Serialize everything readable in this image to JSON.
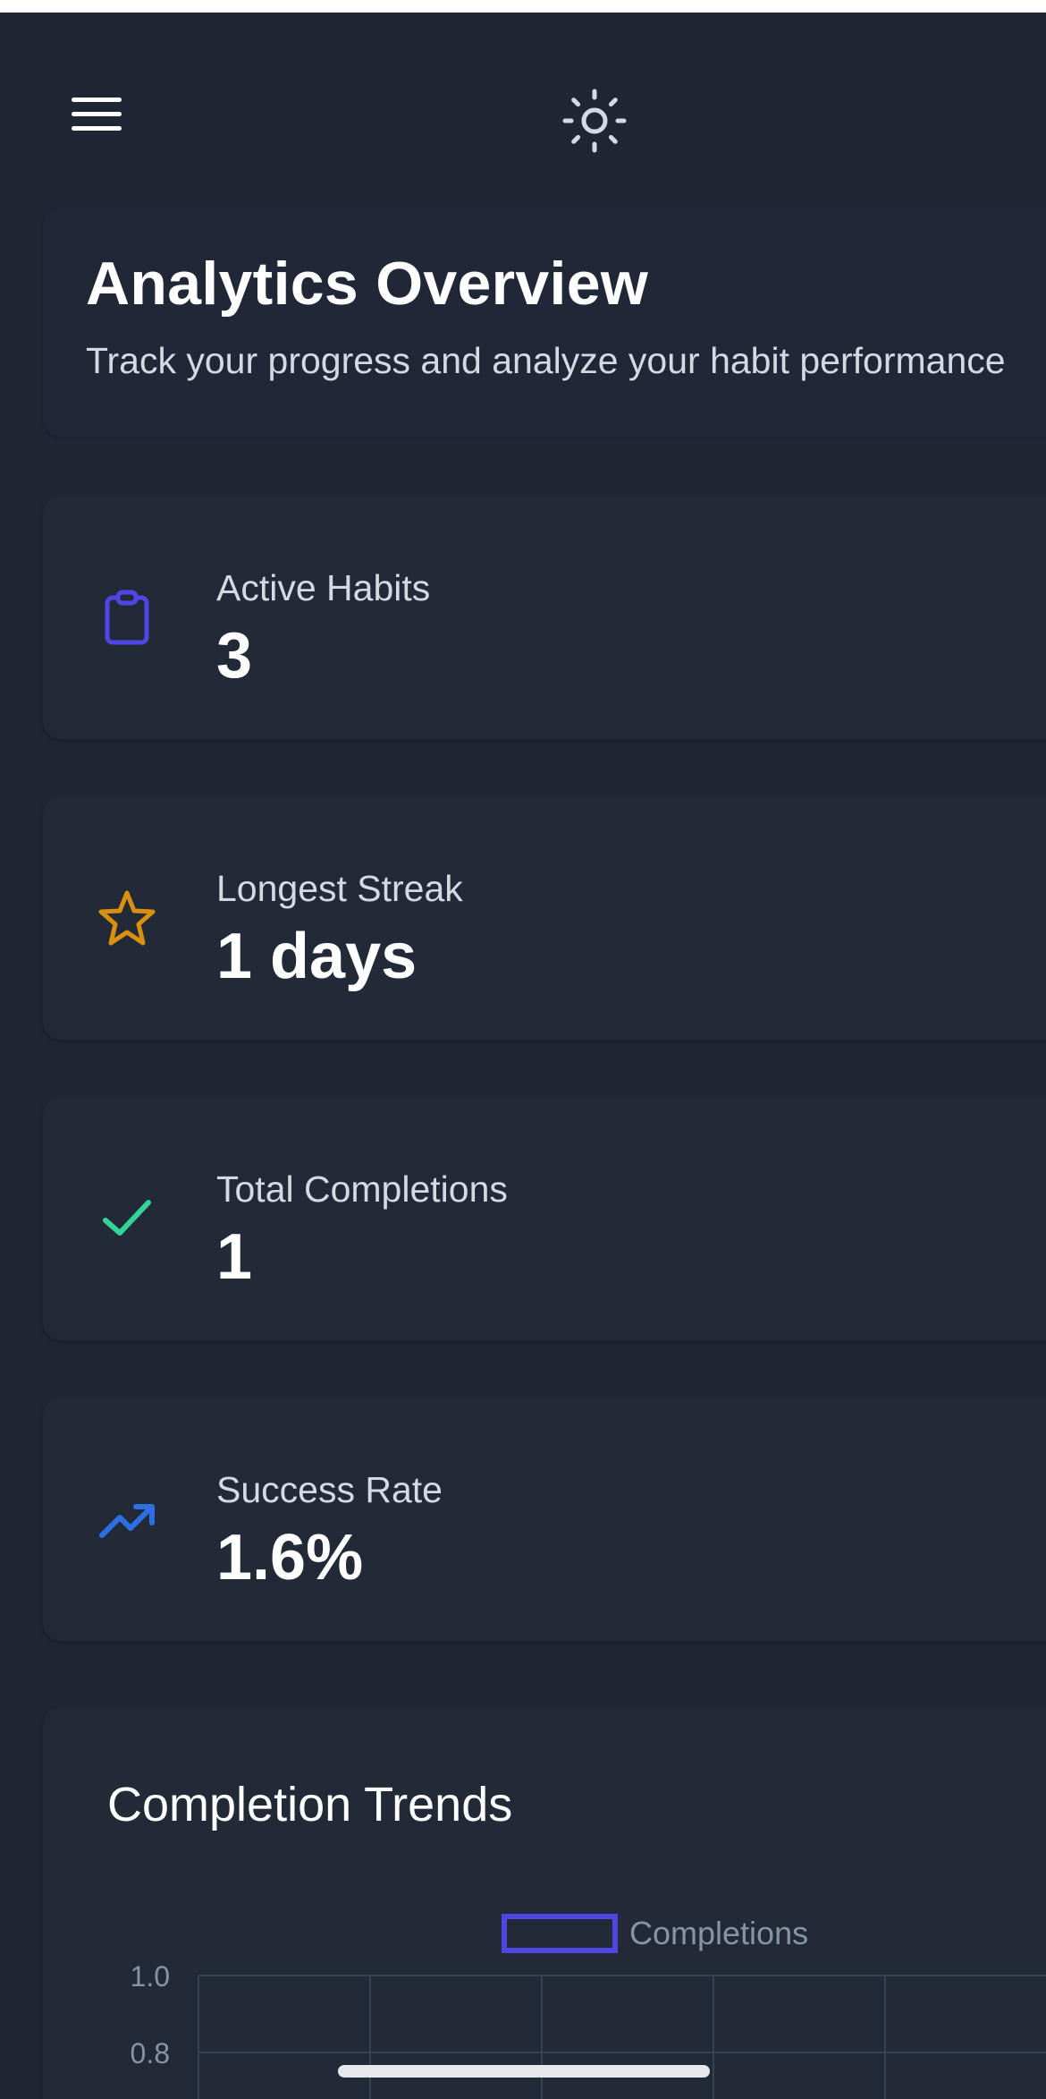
{
  "header": {
    "menu_icon": "hamburger-menu-icon",
    "theme_icon": "sun-icon"
  },
  "hero": {
    "title": "Analytics Overview",
    "subtitle": "Track your progress and analyze your habit performance"
  },
  "stats": [
    {
      "label": "Active Habits",
      "value": "3",
      "icon": "clipboard-icon",
      "color": "#4f46e5"
    },
    {
      "label": "Longest Streak",
      "value": "1 days",
      "icon": "star-icon",
      "color": "#d9900f"
    },
    {
      "label": "Total Completions",
      "value": "1",
      "icon": "check-icon",
      "color": "#34d399"
    },
    {
      "label": "Success Rate",
      "value": "1.6%",
      "icon": "trending-up-icon",
      "color": "#2f6fe6"
    }
  ],
  "chart": {
    "title": "Completion Trends"
  },
  "chart_data": {
    "type": "line",
    "series": [
      {
        "name": "Completions",
        "values": []
      }
    ],
    "y_ticks": [
      "1.0",
      "0.8"
    ],
    "grid": true,
    "legend": "top-center",
    "colors": {
      "series": "#4f46e5",
      "grid": "#364152",
      "tick": "#8a93a3"
    }
  }
}
